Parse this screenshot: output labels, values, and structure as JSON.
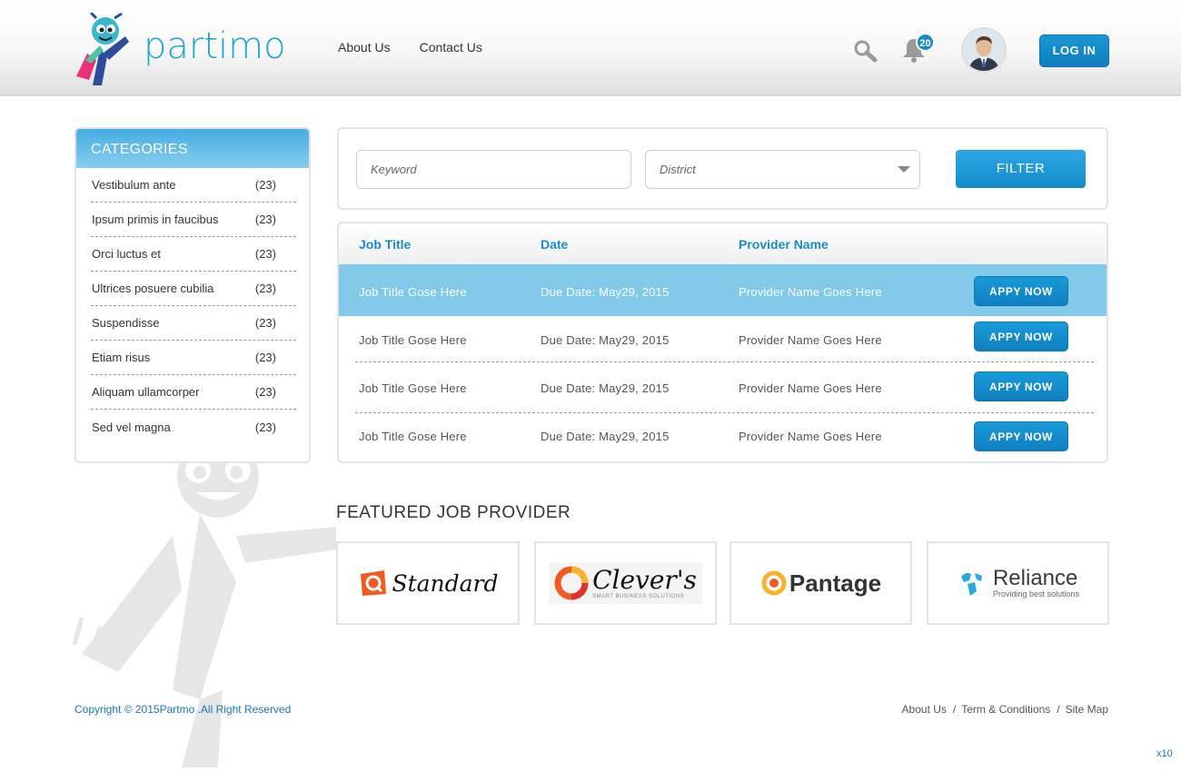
{
  "header": {
    "logo_text": "partimo",
    "nav": [
      "About Us",
      "Contact Us"
    ],
    "notification_count": "20",
    "login_label": "LOG IN"
  },
  "categories": {
    "title": "CATEGORIES",
    "items": [
      {
        "label": "Vestibulum ante",
        "count": "(23)"
      },
      {
        "label": "Ipsum primis in faucibus",
        "count": "(23)"
      },
      {
        "label": "Orci luctus et",
        "count": "(23)"
      },
      {
        "label": "Ultrices posuere cubilia",
        "count": "(23)"
      },
      {
        "label": "Suspendisse",
        "count": "(23)"
      },
      {
        "label": "Etiam risus",
        "count": "(23)"
      },
      {
        "label": "Aliquam ullamcorper",
        "count": "(23)"
      },
      {
        "label": "Sed vel magna",
        "count": "(23)"
      }
    ]
  },
  "filter": {
    "keyword_placeholder": "Keyword",
    "district_placeholder": "District",
    "button_label": "FILTER"
  },
  "jobs": {
    "columns": [
      "Job Title",
      "Date",
      "Provider Name"
    ],
    "rows": [
      {
        "title": "Job Title Gose Here",
        "date": "Due Date: May29, 2015",
        "provider": "Provider Name Goes Here",
        "action": "APPY NOW"
      },
      {
        "title": "Job Title Gose Here",
        "date": "Due Date: May29, 2015",
        "provider": "Provider Name Goes Here",
        "action": "APPY NOW"
      },
      {
        "title": "Job Title Gose Here",
        "date": "Due Date: May29, 2015",
        "provider": "Provider Name Goes Here",
        "action": "APPY NOW"
      },
      {
        "title": "Job Title Gose Here",
        "date": "Due Date: May29, 2015",
        "provider": "Provider Name Goes Here",
        "action": "APPY NOW"
      }
    ]
  },
  "featured": {
    "title": "FEATURED JOB PROVIDER",
    "providers": [
      {
        "name": "Standard",
        "tagline": ""
      },
      {
        "name": "Clever's",
        "tagline": "SMART BUSINESS SOLUTIONS"
      },
      {
        "name": "Pantage",
        "tagline": ""
      },
      {
        "name": "Reliance",
        "tagline": "Providing best solutions"
      }
    ]
  },
  "footer": {
    "copyright": "Copyright © 2015Partmo .All Right Reserved",
    "links": [
      "About Us",
      "Term & Conditions",
      "Site Map"
    ],
    "corner_label": "x10"
  }
}
